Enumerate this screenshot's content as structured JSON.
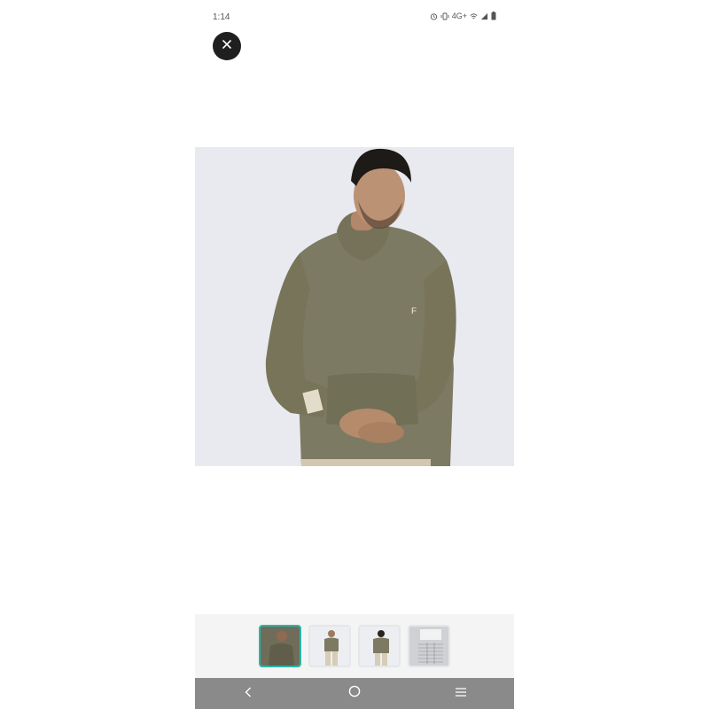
{
  "status_bar": {
    "time": "1:14",
    "network": "4G+",
    "icons": [
      "alarm-icon",
      "vibrate-icon",
      "wifi-icon",
      "signal-icon",
      "battery-icon"
    ]
  },
  "header": {
    "close_icon": "close-icon"
  },
  "product": {
    "main_image": "olive-hoodie-model-photo",
    "colors": {
      "hoodie": "#7d7a63",
      "background": "#e6e8ee"
    }
  },
  "thumbnails": [
    {
      "image": "hoodie-front-closeup",
      "selected": true
    },
    {
      "image": "hoodie-full-body",
      "selected": false
    },
    {
      "image": "hoodie-full-body-alt",
      "selected": false
    },
    {
      "image": "size-chart",
      "selected": false
    }
  ],
  "nav_bar": {
    "buttons": [
      "back-icon",
      "home-icon",
      "recents-icon"
    ]
  },
  "colors": {
    "accent": "#2bb5a8",
    "nav_bar": "#8a8a8a",
    "close_button": "#1f1f1f"
  }
}
